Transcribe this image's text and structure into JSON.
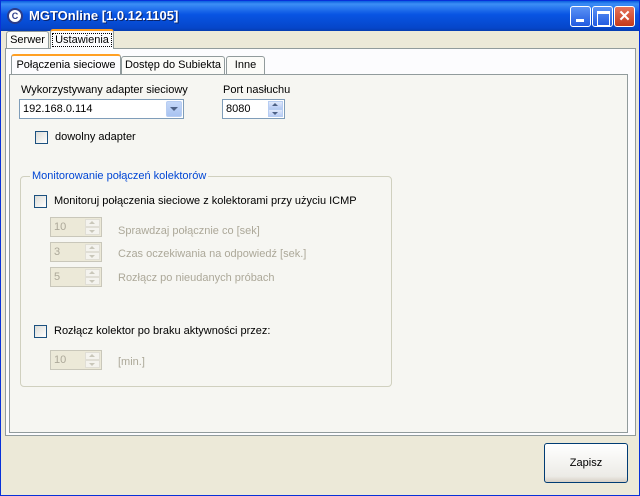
{
  "window": {
    "title": "MGTOnline [1.0.12.1105]",
    "icon_letter": "C",
    "controls": [
      "minimize-icon",
      "maximize-icon",
      "close-icon"
    ],
    "close_glyph": "✕"
  },
  "outer_tabs": [
    {
      "label": "Serwer",
      "selected": false
    },
    {
      "label": "Ustawienia",
      "selected": true
    }
  ],
  "inner_tabs": [
    {
      "label": "Połączenia sieciowe",
      "selected": true
    },
    {
      "label": "Dostęp do Subiekta",
      "selected": false
    },
    {
      "label": "Inne",
      "selected": false
    }
  ],
  "network": {
    "adapter_label": "Wykorzystywany adapter sieciowy",
    "adapter_value": "192.168.0.114",
    "port_label": "Port nasłuchu",
    "port_value": "8080",
    "any_adapter_label": "dowolny adapter",
    "any_adapter_checked": false
  },
  "monitoring": {
    "group_title": "Monitorowanie połączeń kolektorów",
    "icmp_label": "Monitoruj połączenia  sieciowe z kolektorami przy użyciu ICMP",
    "icmp_checked": false,
    "check_every_value": "10",
    "check_every_label": "Sprawdzaj połącznie co [sek]",
    "timeout_value": "3",
    "timeout_label": "Czas oczekiwania na odpowiedź [sek.]",
    "retries_value": "5",
    "retries_label": "Rozłącz po nieudanych próbach",
    "inactivity_label": "Rozłącz kolektor po braku aktywności przez:",
    "inactivity_checked": false,
    "inactivity_value": "10",
    "inactivity_unit": "[min.]"
  },
  "buttons": {
    "save": "Zapisz"
  },
  "colors": {
    "titlebar": "#0854e3",
    "group_title": "#0046d5",
    "tab_highlight": "#ff9f23",
    "disabled_text": "#aca899"
  }
}
